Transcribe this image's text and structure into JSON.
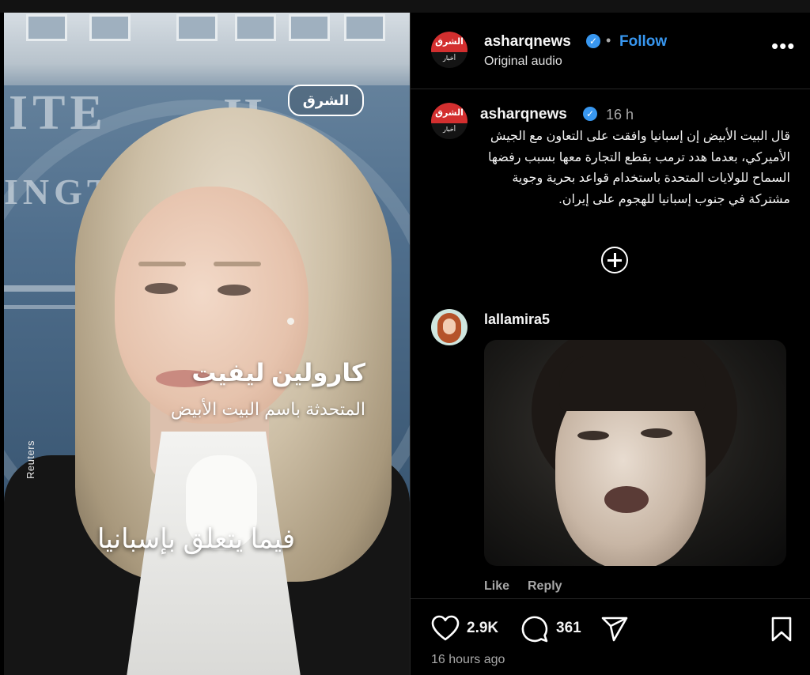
{
  "post": {
    "account": "asharqnews",
    "follow_label": "Follow",
    "dot": "•",
    "audio": "Original audio",
    "more": "•••",
    "avatar_brand": "الشرق",
    "avatar_sub": "أخبار"
  },
  "video": {
    "logo": "الشرق",
    "name_caption": "كارولين ليفيت",
    "role_caption": "المتحدثة باسم البيت الأبيض",
    "quote_caption": "فيما يتعلق بإسبانيا",
    "credit": "Reuters",
    "backdrop_left": "ITE",
    "backdrop_right": "H",
    "backdrop_line2": "INGT"
  },
  "caption_comment": {
    "account": "asharqnews",
    "time": "16 h",
    "text": "قال البيت الأبيض إن إسبانيا وافقت على التعاون مع الجيش الأميركي، بعدما هدد ترمب بقطع التجارة معها بسبب رفضها السماح للولايات المتحدة باستخدام قواعد بحرية وجوية مشتركة في جنوب إسبانيا للهجوم على إيران."
  },
  "comment": {
    "account": "lallamira5",
    "like_label": "Like",
    "reply_label": "Reply"
  },
  "actions": {
    "likes": "2.9K",
    "comments": "361",
    "posted": "16 hours ago"
  },
  "colors": {
    "accent": "#3897f0",
    "brand_red": "#d32f2f",
    "background": "#000000"
  },
  "icons": [
    "verified-badge-icon",
    "more-options-icon",
    "add-comment-icon",
    "heart-icon",
    "comment-bubble-icon",
    "share-paper-plane-icon",
    "bookmark-icon"
  ]
}
